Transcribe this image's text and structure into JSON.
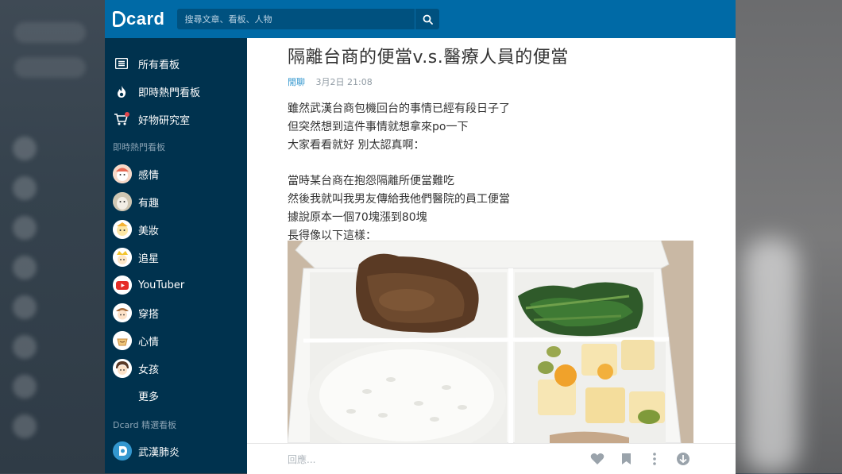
{
  "app": {
    "logo_text": "card"
  },
  "search": {
    "placeholder": "搜尋文章、看板、人物"
  },
  "sidebar": {
    "main_items": [
      {
        "label": "所有看板",
        "icon": "list-icon"
      },
      {
        "label": "即時熱門看板",
        "icon": "fire-icon"
      },
      {
        "label": "好物研究室",
        "icon": "cart-icon"
      }
    ],
    "hot_section_title": "即時熱門看板",
    "hot_boards": [
      {
        "label": "感情"
      },
      {
        "label": "有趣"
      },
      {
        "label": "美妝"
      },
      {
        "label": "追星"
      },
      {
        "label": "YouTuber"
      },
      {
        "label": "穿搭"
      },
      {
        "label": "心情"
      },
      {
        "label": "女孩"
      }
    ],
    "more_label": "更多",
    "featured_section_title": "Dcard 精選看板",
    "featured_boards": [
      {
        "label": "武漢肺炎"
      }
    ]
  },
  "post": {
    "title": "隔離台商的便當v.s.醫療人員的便當",
    "board": "閒聊",
    "date": "3月2日 21:08",
    "body": "雖然武漢台商包機回台的事情已經有段日子了\n但突然想到這件事情就想拿來po一下\n大家看看就好 別太認真啊：\n\n當時某台商在抱怨隔離所便當難吃\n然後我就叫我男友傳給我他們醫院的員工便當\n據說原本一個70塊漲到80塊\n長得像以下這樣："
  },
  "reply": {
    "placeholder": "回應..."
  },
  "colors": {
    "topbar": "#006aa6",
    "sidebar": "#00324e",
    "accent": "#3397cf"
  }
}
